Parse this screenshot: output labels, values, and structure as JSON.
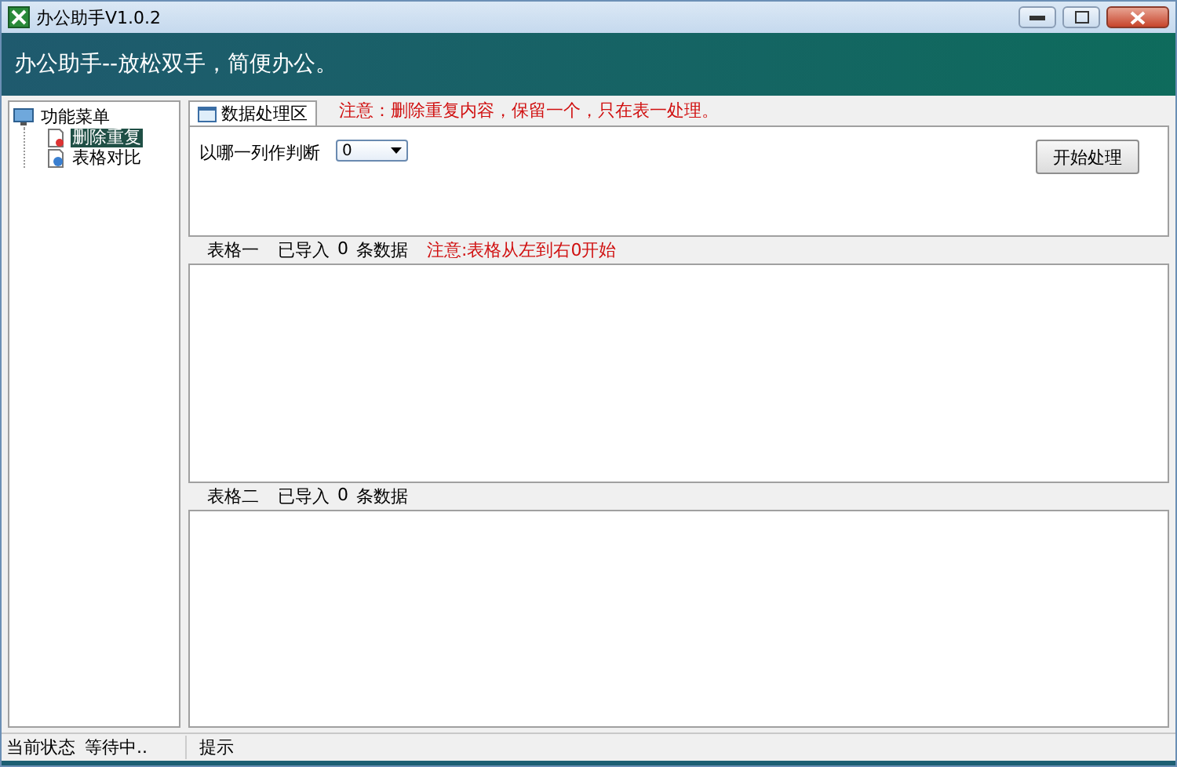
{
  "window": {
    "title": "办公助手V1.0.2"
  },
  "banner": "办公助手--放松双手，简便办公。",
  "sidebar": {
    "root": {
      "label": "功能菜单",
      "expanded": true,
      "children": [
        {
          "label": "删除重复",
          "selected": true
        },
        {
          "label": "表格对比",
          "selected": false
        }
      ]
    }
  },
  "tabs": [
    {
      "label": "数据处理区",
      "selected": true
    }
  ],
  "notice": "注意：删除重复内容，保留一个，只在表一处理。",
  "column_select": {
    "label": "以哪一列作判断",
    "value": "0"
  },
  "start_button": "开始处理",
  "tables": [
    {
      "name": "表格一",
      "imported": "已导入",
      "count": "0",
      "unit": "条数据",
      "note": "注意:表格从左到右0开始"
    },
    {
      "name": "表格二",
      "imported": "已导入",
      "count": "0",
      "unit": "条数据"
    }
  ],
  "status_bar": {
    "label": "当前状态",
    "state": "等待中..",
    "hint": "提示"
  }
}
